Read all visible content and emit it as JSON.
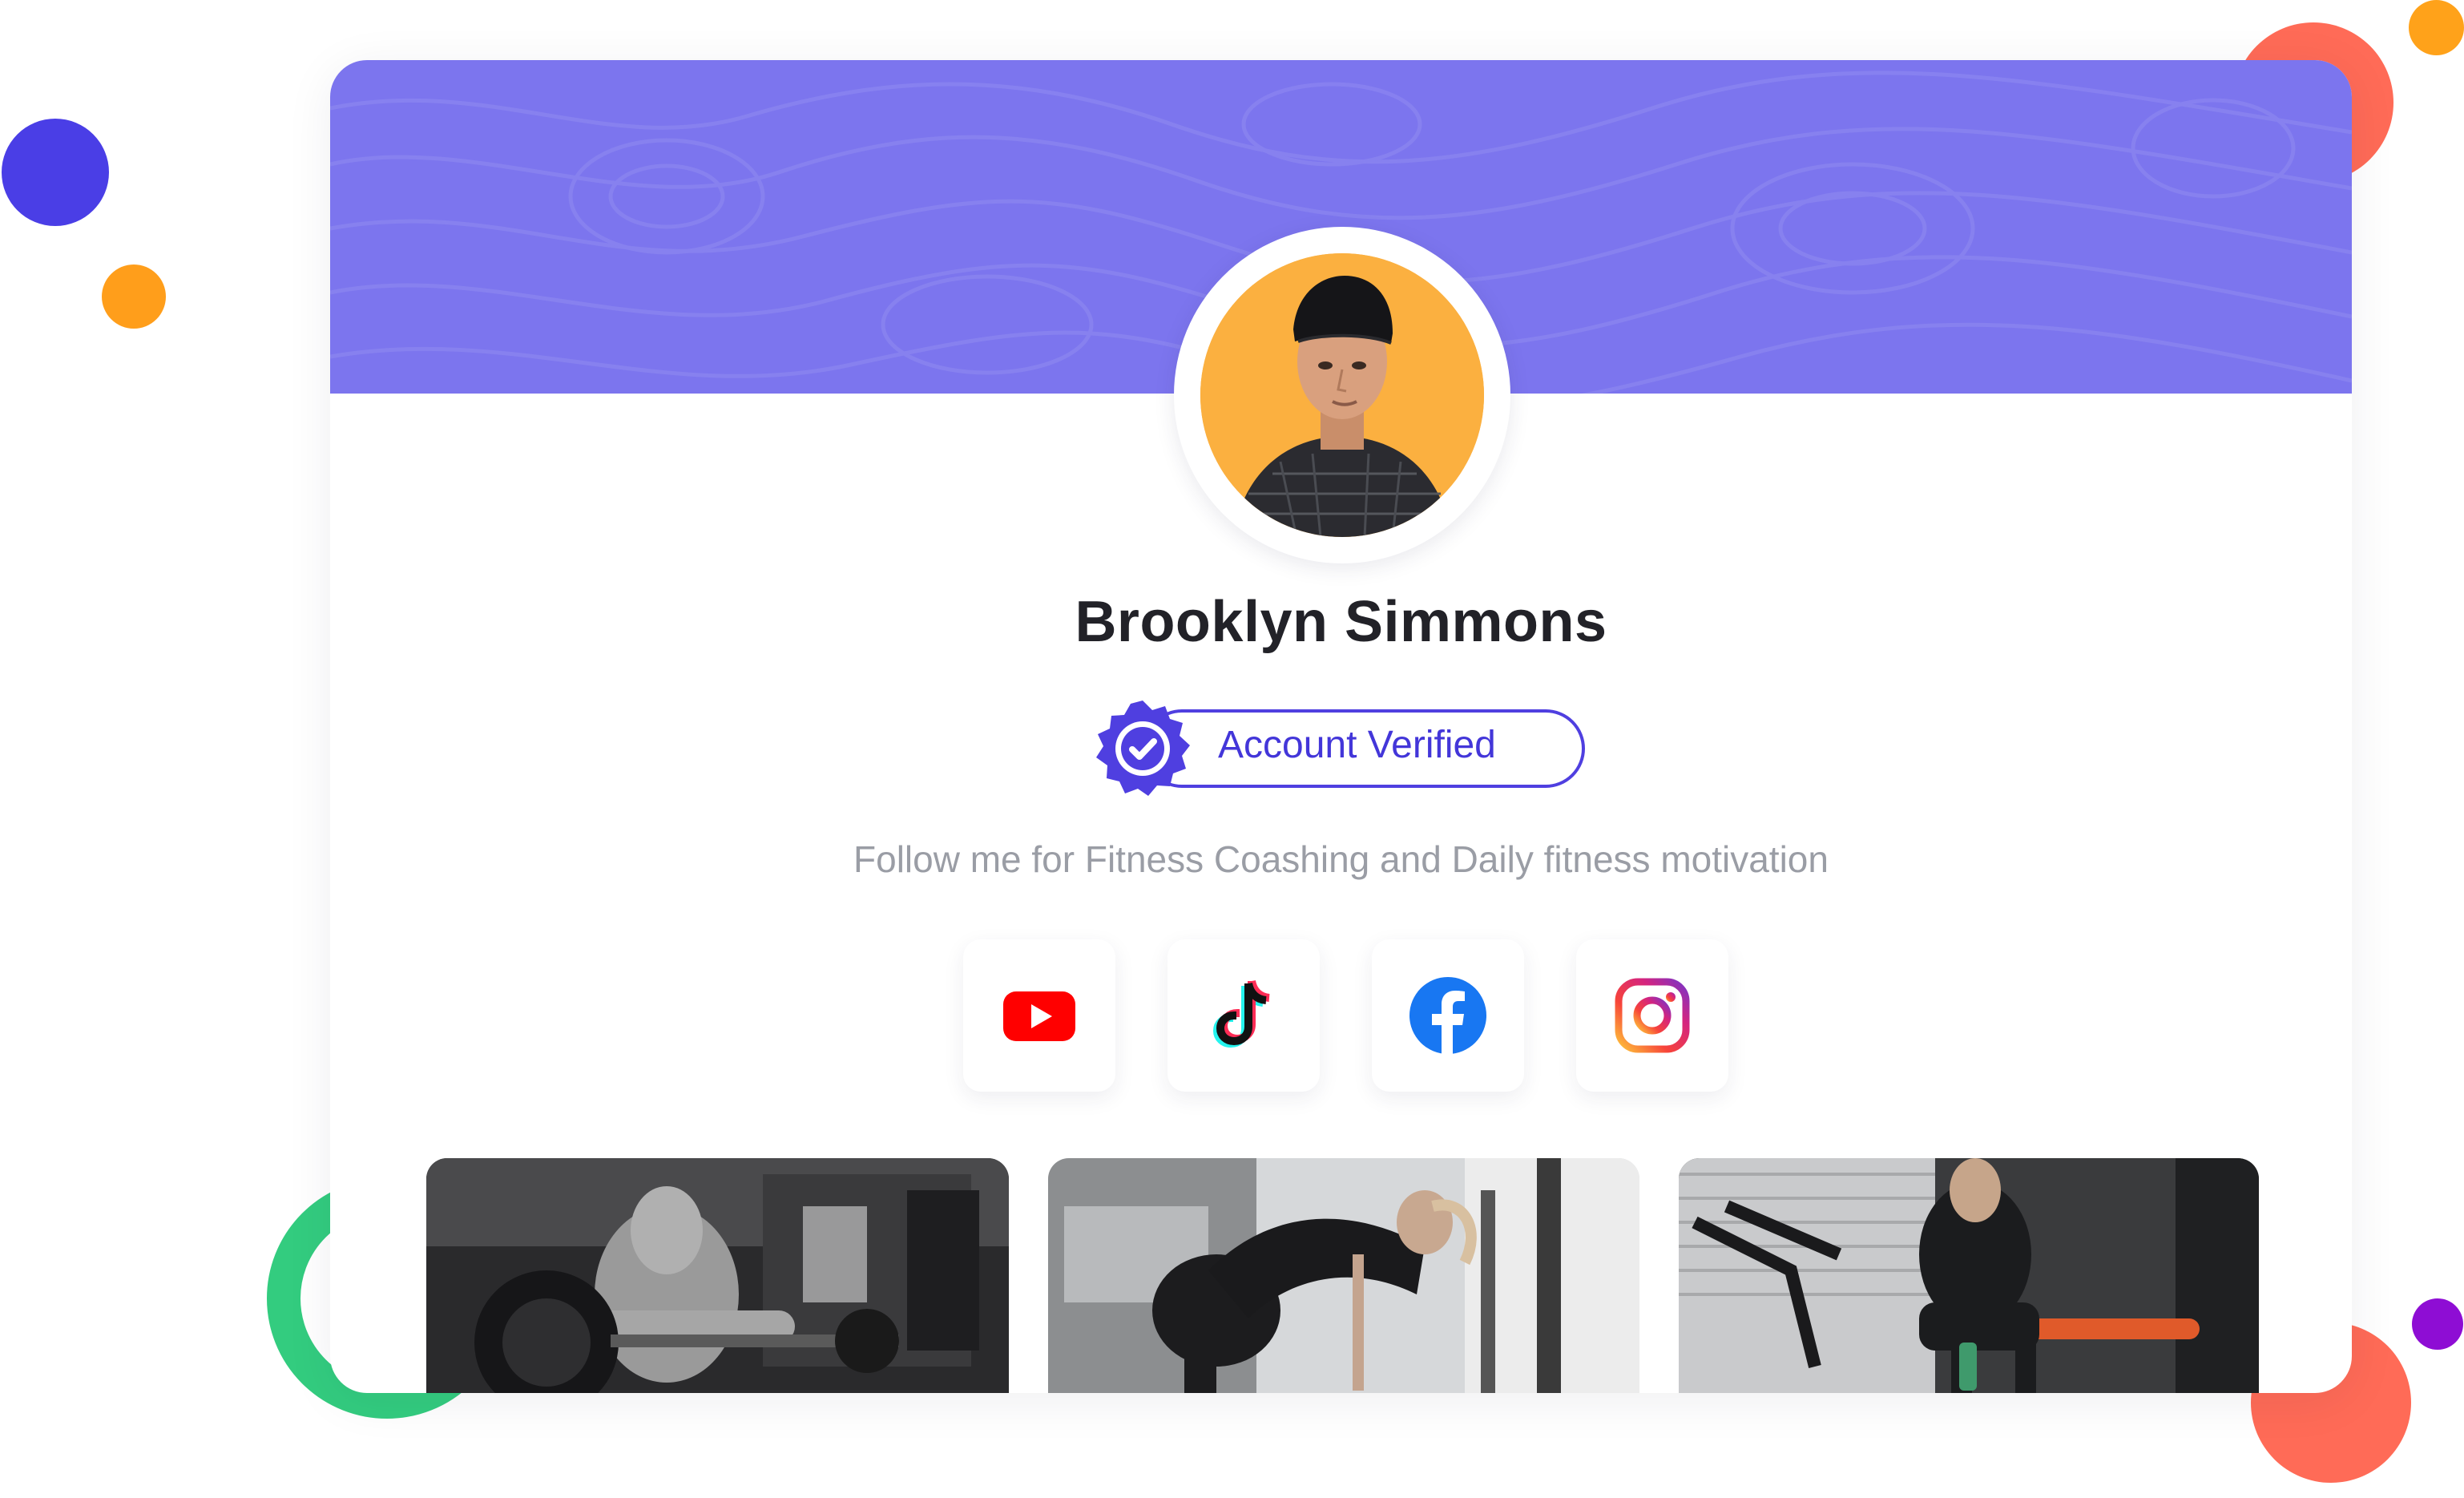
{
  "profile": {
    "name": "Brooklyn Simmons",
    "verified_label": "Account Verified",
    "bio": "Follow me for Fitness Coashing and Daily fitness motivation"
  },
  "socials": [
    {
      "name": "YouTube",
      "icon": "youtube-icon",
      "color": "#FF0000"
    },
    {
      "name": "TikTok",
      "icon": "tiktok-icon",
      "color": "#111111"
    },
    {
      "name": "Facebook",
      "icon": "facebook-icon",
      "color": "#1877F2"
    },
    {
      "name": "Instagram",
      "icon": "instagram-icon",
      "color": "#E1306C"
    }
  ],
  "gallery": [
    {
      "description_icon": "gym-photo-icon"
    },
    {
      "description_icon": "gym-photo-icon"
    },
    {
      "description_icon": "gym-photo-icon"
    }
  ],
  "colors": {
    "banner": "#7C75EE",
    "accent": "#4F3FE0",
    "avatar_bg": "#FBB040",
    "name": "#222228",
    "bio": "#9A9DA5"
  }
}
